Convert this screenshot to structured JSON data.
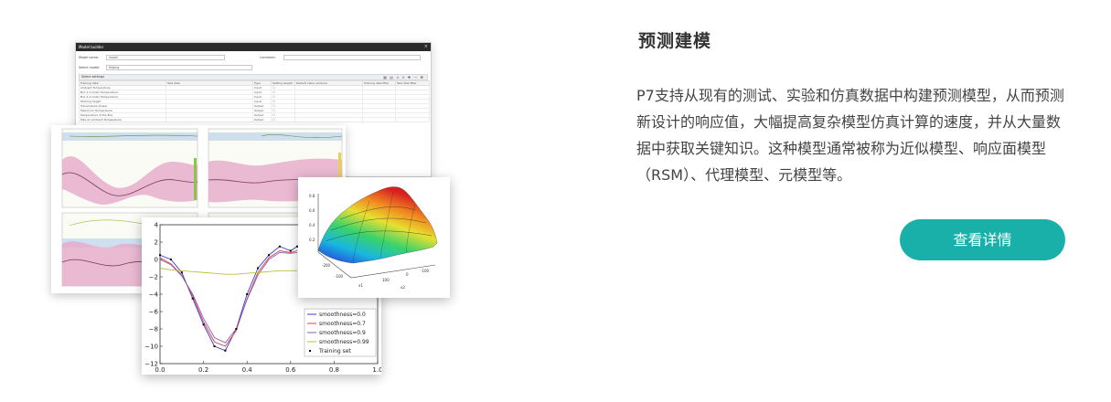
{
  "section": {
    "title": "预测建模",
    "description": "P7支持从现有的测试、实验和仿真数据中构建预测模型，从而预测新设计的响应值，大幅提高复杂模型仿真计算的速度，并从大量数据中获取关键知识。这种模型通常被称为近似模型、响应面模型（RSM）、代理模型、元模型等。",
    "button_label": "查看详情"
  },
  "colors": {
    "accent": "#1ab0aa",
    "title": "#333333",
    "text": "#444444"
  },
  "illustration": {
    "window": {
      "title": "Model builder",
      "fields": [
        {
          "label": "Model name:",
          "value": "model"
        },
        {
          "label": "Select model:",
          "value": "Kriging"
        }
      ],
      "comment_label": "Comment:",
      "subpanel_title": "Select settings",
      "table_headers": [
        "Training data",
        "Test data",
        "Type",
        "Setting weight",
        "Default value variance",
        "Training data filter",
        "Test data filter"
      ],
      "table_rows": [
        [
          "Ambient Temperature",
          "",
          "Input"
        ],
        [
          "Box 1-A Outer Temperature",
          "",
          "Input"
        ],
        [
          "Box 2-A Outer Temperature",
          "",
          "Input"
        ],
        [
          "Pitching height",
          "",
          "Input"
        ],
        [
          "Transmission Power",
          "",
          "Output"
        ],
        [
          "Maximum Temperature",
          "",
          "Output"
        ],
        [
          "Temperature of the Box",
          "",
          "Output"
        ],
        [
          "Max air Ambient Temperature",
          "",
          "Output"
        ]
      ]
    },
    "smoothness_chart": {
      "chart_data": {
        "type": "line",
        "xlim": [
          0.0,
          1.0
        ],
        "ylim": [
          -12,
          4
        ],
        "xticks": [
          "0.0",
          "0.2",
          "0.4",
          "0.6",
          "0.8",
          "1.0"
        ],
        "yticks": [
          "4",
          "2",
          "0",
          "−2",
          "−4",
          "−6",
          "−8",
          "−10",
          "−12"
        ],
        "x": [
          0.0,
          0.05,
          0.1,
          0.15,
          0.2,
          0.25,
          0.3,
          0.35,
          0.4,
          0.45,
          0.5,
          0.55,
          0.6,
          0.63
        ],
        "series": [
          {
            "name": "smoothness=0.0",
            "color": "#3a3ad6",
            "values": [
              0.5,
              0.0,
              -1.5,
              -4.5,
              -7.5,
              -10.0,
              -10.5,
              -8.0,
              -4.0,
              -1.0,
              0.5,
              1.5,
              1.0,
              1.5
            ]
          },
          {
            "name": "smoothness=0.7",
            "color": "#d94040",
            "values": [
              0.2,
              -0.5,
              -1.8,
              -4.2,
              -7.2,
              -9.5,
              -10.0,
              -8.2,
              -4.5,
              -1.5,
              0.2,
              1.0,
              0.8,
              1.0
            ]
          },
          {
            "name": "smoothness=0.9",
            "color": "#8a5fb0",
            "values": [
              0.0,
              -0.6,
              -1.9,
              -4.0,
              -6.8,
              -9.0,
              -9.6,
              -8.0,
              -4.6,
              -1.8,
              0.0,
              0.8,
              0.7,
              0.8
            ]
          },
          {
            "name": "smoothness=0.99",
            "color": "#b8c23a",
            "values": [
              -1.0,
              -1.2,
              -1.3,
              -1.4,
              -1.5,
              -1.6,
              -1.7,
              -1.7,
              -1.6,
              -1.5,
              -1.4,
              -1.3,
              -1.3,
              -1.3
            ]
          }
        ],
        "training_set": {
          "name": "Training set",
          "color": "#000000"
        },
        "legend_position": "bottom-right"
      }
    }
  }
}
